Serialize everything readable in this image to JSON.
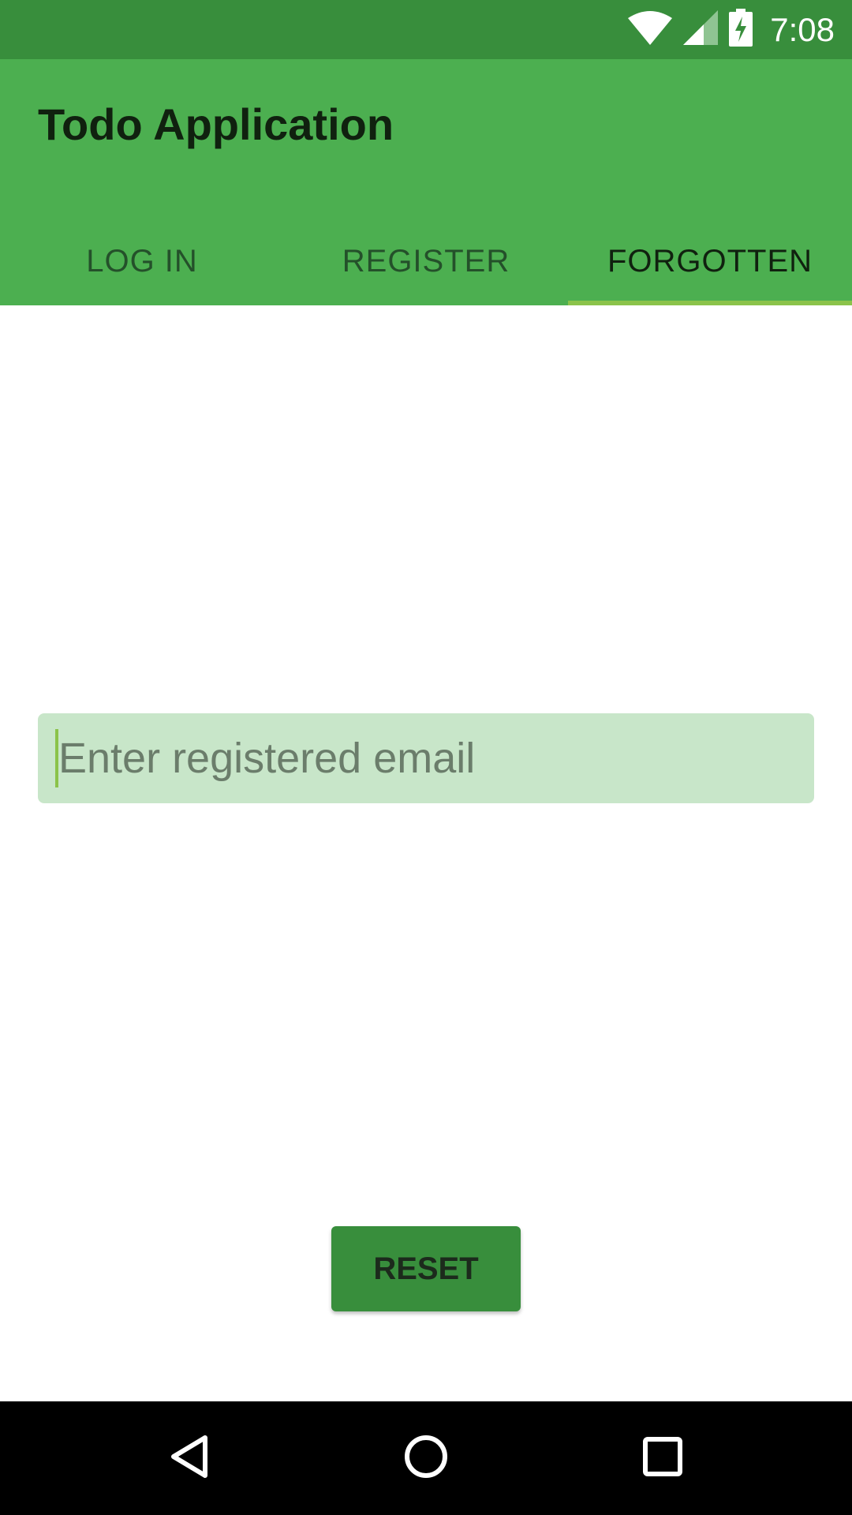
{
  "status_bar": {
    "time": "7:08",
    "icons": [
      "wifi-icon",
      "cell-signal-icon",
      "battery-charging-icon"
    ],
    "background": "#388e3c"
  },
  "app_bar": {
    "title": "Todo Application",
    "background": "#4caf50"
  },
  "tabs": [
    {
      "label": "LOG IN",
      "active": false
    },
    {
      "label": "REGISTER",
      "active": false
    },
    {
      "label": "FORGOTTEN",
      "active": true
    }
  ],
  "tab_indicator_color": "#8bc34a",
  "email_field": {
    "value": "",
    "placeholder": "Enter registered email",
    "background": "#c8e6c9"
  },
  "reset_button": {
    "label": "RESET",
    "background": "#388e3c"
  },
  "nav_bar": {
    "buttons": [
      "back-icon",
      "home-icon",
      "recents-icon"
    ]
  }
}
